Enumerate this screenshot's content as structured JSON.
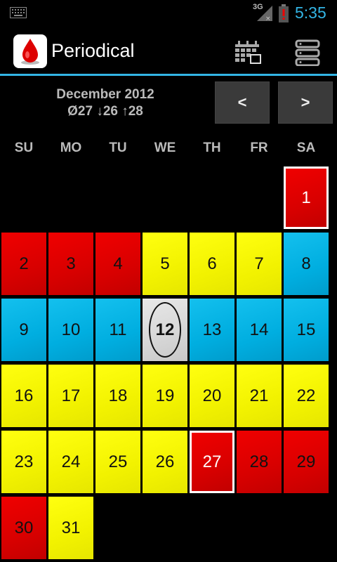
{
  "status_bar": {
    "time": "5:35",
    "network": "3G",
    "icons": [
      "keyboard-icon",
      "signal-icon",
      "battery-alert-icon"
    ],
    "clock_color": "#33b5e5"
  },
  "action_bar": {
    "title": "Periodical",
    "app_icon": "blood-drop-icon",
    "actions": [
      "calendar-icon",
      "list-icon"
    ],
    "accent_color": "#33b5e5"
  },
  "header": {
    "month": "December 2012",
    "stats": "Ø27 ↓26 ↑28",
    "prev_label": "<",
    "next_label": ">"
  },
  "weekdays": [
    "SU",
    "MO",
    "TU",
    "WE",
    "TH",
    "FR",
    "SA"
  ],
  "colors": {
    "red": "#e00000",
    "yellow": "#f2f200",
    "blue": "#00aee0",
    "gray": "#d6d6d6"
  },
  "days": [
    {
      "day": "1",
      "type": "red",
      "outlined": true
    },
    {
      "day": "2",
      "type": "red"
    },
    {
      "day": "3",
      "type": "red"
    },
    {
      "day": "4",
      "type": "red"
    },
    {
      "day": "5",
      "type": "yellow"
    },
    {
      "day": "6",
      "type": "yellow"
    },
    {
      "day": "7",
      "type": "yellow"
    },
    {
      "day": "8",
      "type": "blue"
    },
    {
      "day": "9",
      "type": "blue"
    },
    {
      "day": "10",
      "type": "blue"
    },
    {
      "day": "11",
      "type": "blue"
    },
    {
      "day": "12",
      "type": "gray",
      "today": true
    },
    {
      "day": "13",
      "type": "blue"
    },
    {
      "day": "14",
      "type": "blue"
    },
    {
      "day": "15",
      "type": "blue"
    },
    {
      "day": "16",
      "type": "yellow"
    },
    {
      "day": "17",
      "type": "yellow"
    },
    {
      "day": "18",
      "type": "yellow"
    },
    {
      "day": "19",
      "type": "yellow"
    },
    {
      "day": "20",
      "type": "yellow"
    },
    {
      "day": "21",
      "type": "yellow"
    },
    {
      "day": "22",
      "type": "yellow"
    },
    {
      "day": "23",
      "type": "yellow"
    },
    {
      "day": "24",
      "type": "yellow"
    },
    {
      "day": "25",
      "type": "yellow"
    },
    {
      "day": "26",
      "type": "yellow"
    },
    {
      "day": "27",
      "type": "red",
      "outlined": true
    },
    {
      "day": "28",
      "type": "red"
    },
    {
      "day": "29",
      "type": "red"
    },
    {
      "day": "30",
      "type": "red"
    },
    {
      "day": "31",
      "type": "yellow"
    }
  ]
}
